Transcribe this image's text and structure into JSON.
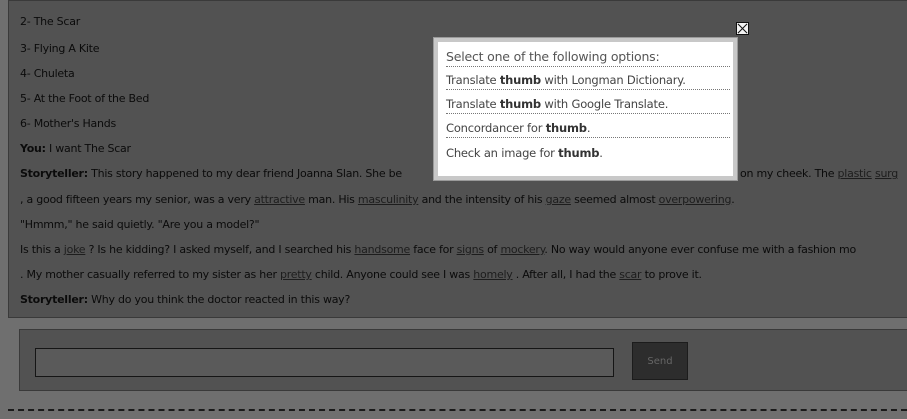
{
  "story": {
    "options": [
      "2- The Scar",
      "3- Flying A Kite",
      "4- Chuleta",
      "5- At the Foot of the Bed",
      "6- Mother's Hands"
    ],
    "you_label": "You:",
    "you_text": " I want The Scar",
    "storyteller_label": "Storyteller:",
    "storyteller_text_1": " This story happened to my dear friend Joanna Slan. She be",
    "storyteller_text_1_right": " on my cheek. The ",
    "line1_words": [
      "plastic",
      "surg"
    ],
    "line2_parts": [
      ", a good fifteen years my senior, was a very ",
      "attractive",
      " man. His ",
      "masculinity",
      " and the intensity of his ",
      "gaze",
      " seemed almost ",
      "overpowering",
      "."
    ],
    "line3": "\"Hmmm,\" he said quietly. \"Are you a model?\"",
    "line4_parts": [
      "Is this a ",
      "joke",
      " ? Is he kidding? I asked myself, and I searched his ",
      "handsome",
      " face for ",
      "signs",
      " of ",
      "mockery",
      ". No way would anyone ever confuse me with a fashion mo"
    ],
    "line5_parts": [
      ". My mother casually referred to my sister as her ",
      "pretty",
      " child. Anyone could see I was ",
      "homely",
      " . After all, I had the ",
      "scar",
      " to prove it."
    ],
    "storyteller_question": " Why do you think the doctor reacted in this way?"
  },
  "popup": {
    "title": "Select one of the following options:",
    "word": "thumb",
    "option1_pre": "Translate ",
    "option1_post": " with Longman Dictionary.",
    "option2_pre": "Translate ",
    "option2_post": " with Google Translate.",
    "option3_pre": "Concordancer for ",
    "option3_post": ".",
    "option4_pre": "Check an image for ",
    "option4_post": "."
  },
  "chat": {
    "input_value": "",
    "send_label": "Send"
  }
}
